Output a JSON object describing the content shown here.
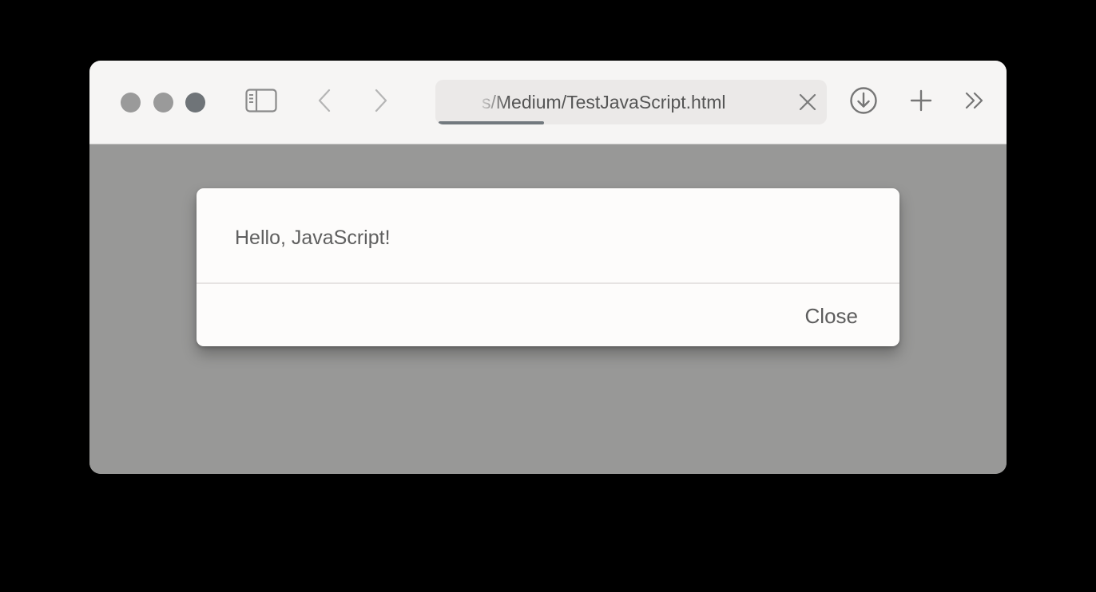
{
  "window": {
    "traffic_lights": [
      {
        "name": "close",
        "color": "#9a9a9a"
      },
      {
        "name": "minimize",
        "color": "#9a9a9a"
      },
      {
        "name": "zoom",
        "color": "#6f7478"
      }
    ]
  },
  "toolbar": {
    "icons": {
      "sidebar": "sidebar-icon",
      "back": "chevron-left-icon",
      "forward": "chevron-right-icon",
      "download": "download-icon",
      "new_tab": "plus-icon",
      "more": "double-chevron-right-icon"
    },
    "address": {
      "value": "s/Medium/TestJavaScript.html",
      "clear_icon": "close-icon",
      "progress": 0.27
    }
  },
  "dialog": {
    "message": "Hello, JavaScript!",
    "close_label": "Close"
  },
  "colors": {
    "toolbar_bg": "#f6f5f4",
    "page_overlay": "#989897",
    "dialog_bg": "#fdfcfb",
    "progress": "#72797e"
  }
}
